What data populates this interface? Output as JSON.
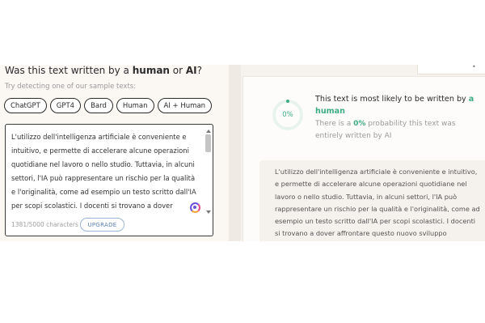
{
  "detector": {
    "heading_prefix": "Was this text written by a ",
    "heading_human": "human",
    "heading_middle": " or ",
    "heading_ai": "AI",
    "heading_suffix": "?",
    "sample_hint": "Try detecting one of our sample texts:",
    "samples": [
      "ChatGPT",
      "GPT4",
      "Bard",
      "Human",
      "AI + Human"
    ],
    "input_text": "L'utilizzo dell'intelligenza artificiale è conveniente e intuitivo, e permette di accelerare alcune operazioni quotidiane nel lavoro o nello studio. Tuttavia, in alcuni settori, l'IA può rappresentare un rischio per la qualità e l'originalità, come ad esempio un testo scritto dall'IA per scopi scolastici. I docenti si trovano a dover affrontare questo nuovo sviluppo",
    "char_count": "1381/5000 characters",
    "upgrade_label": "UPGRADE"
  },
  "result": {
    "gauge_percent": "0%",
    "gauge_value": 0,
    "verdict_prefix": "This text is most likely to be written by ",
    "verdict_a": "a",
    "verdict_human": "human",
    "prob_prefix": "There is a ",
    "prob_value": "0%",
    "prob_suffix": " probability this text was entirely written by AI",
    "analyzed_text": "L'utilizzo dell'intelligenza artificiale è conveniente e intuitivo, e permette di accelerare alcune operazioni quotidiane nel lavoro o nello studio. Tuttavia, in alcuni settori, l'IA può rappresentare un rischio per la qualità e l'originalità, come ad esempio un testo scritto dall'IA per scopi scolastici. I docenti si trovano a dover affrontare questo nuovo sviluppo",
    "top_card_glyph": "•"
  },
  "colors": {
    "accent_green": "#3dab84",
    "gauge_track": "#e9f3ee",
    "upgrade_blue": "#5a7fae"
  },
  "icons": {
    "grammar_extension": "grammar-assistant-icon"
  }
}
